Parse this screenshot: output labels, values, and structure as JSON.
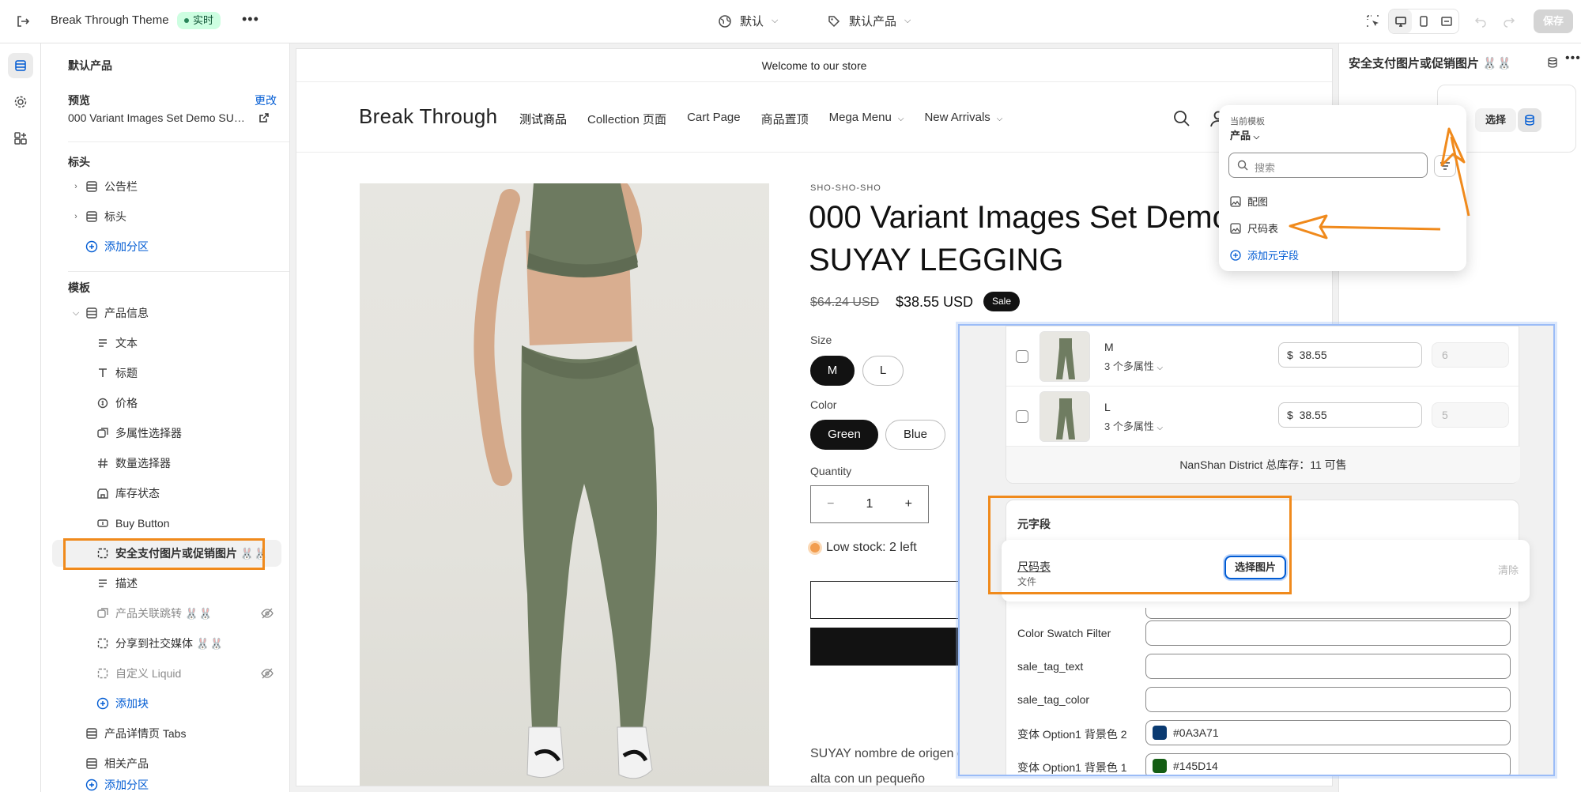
{
  "topbar": {
    "theme_name": "Break Through Theme",
    "live_badge": "实时",
    "default_label": "默认",
    "template_label": "默认产品",
    "save_label": "保存"
  },
  "sidebar": {
    "title": "默认产品",
    "preview_label": "预览",
    "change_link": "更改",
    "preview_value": "000 Variant Images Set Demo SUYAY LEGGING",
    "header_section_title": "标头",
    "header_items": [
      {
        "label": "公告栏"
      },
      {
        "label": "标头"
      }
    ],
    "add_section_1": "添加分区",
    "template_section_title": "模板",
    "product_info_label": "产品信息",
    "blocks": [
      {
        "label": "文本",
        "icon": "text-lines-icon"
      },
      {
        "label": "标题",
        "icon": "title-t-icon"
      },
      {
        "label": "价格",
        "icon": "price-tag-icon"
      },
      {
        "label": "多属性选择器",
        "icon": "variant-picker-icon"
      },
      {
        "label": "数量选择器",
        "icon": "hash-icon"
      },
      {
        "label": "库存状态",
        "icon": "store-icon"
      },
      {
        "label": "Buy Button",
        "icon": "buy-button-icon"
      },
      {
        "label": "安全支付图片或促销图片 🐰🐰",
        "icon": "dashed-frame-icon"
      },
      {
        "label": "描述",
        "icon": "text-lines-icon"
      },
      {
        "label": "产品关联跳转 🐰🐰",
        "icon": "variant-picker-icon"
      },
      {
        "label": "分享到社交媒体 🐰🐰",
        "icon": "dashed-frame-icon"
      },
      {
        "label": "自定义 Liquid",
        "icon": "dashed-frame-icon"
      }
    ],
    "add_block": "添加块",
    "tabs_section": "产品详情页 Tabs",
    "related_section": "相关产品",
    "add_section_2": "添加分区"
  },
  "canvas": {
    "announcement": "Welcome to our store",
    "logo": "Break Through",
    "nav": [
      "测试商品",
      "Collection 页面",
      "Cart Page",
      "商品置顶",
      "Mega Menu",
      "New Arrivals"
    ],
    "vendor": "SHO-SHO-SHO",
    "title": "000 Variant Images Set Demo SUYAY LEGGING",
    "price_old": "$64.24 USD",
    "price_new": "$38.55 USD",
    "sale_tag": "Sale",
    "size_label": "Size",
    "sizes": [
      "M",
      "L"
    ],
    "color_label": "Color",
    "colors": [
      "Green",
      "Blue"
    ],
    "quantity_label": "Quantity",
    "quantity_value": "1",
    "stock_text": "Low stock: 2 left",
    "description": "SUYAY nombre de origen combina a la perfección la comodidad de la cintura alta con un pequeño"
  },
  "right_panel": {
    "title": "安全支付图片或促销图片 🐰🐰",
    "choose_label": "选择"
  },
  "popover": {
    "current_template_label": "当前模板",
    "scope": "产品",
    "search_placeholder": "搜索",
    "items": [
      "配图",
      "尺码表"
    ],
    "add_metafield": "添加元字段"
  },
  "variants": {
    "rows": [
      {
        "name": "M",
        "more": "3 个多属性",
        "price": "38.55",
        "qty": "6"
      },
      {
        "name": "L",
        "more": "3 个多属性",
        "price": "38.55",
        "qty": "5"
      }
    ],
    "currency": "$",
    "total": "NanShan District 总库存：11 可售"
  },
  "metafields": {
    "title": "元字段",
    "size_chart_label": "尺码表",
    "size_chart_type": "文件",
    "choose_image": "选择图片",
    "clear": "清除",
    "fields": [
      {
        "label": "Color Swatch Filter",
        "value": ""
      },
      {
        "label": "sale_tag_text",
        "value": ""
      },
      {
        "label": "sale_tag_color",
        "value": ""
      },
      {
        "label": "变体 Option1 背景色 2",
        "value": "#0A3A71",
        "swatch": "#0A3A71"
      },
      {
        "label": "变体 Option1 背景色 1",
        "value": "#145D14",
        "swatch": "#145D14"
      }
    ]
  },
  "colors": {
    "accent_orange": "#f08a1c",
    "link_blue": "#005bd3",
    "live_green": "#29845a"
  }
}
